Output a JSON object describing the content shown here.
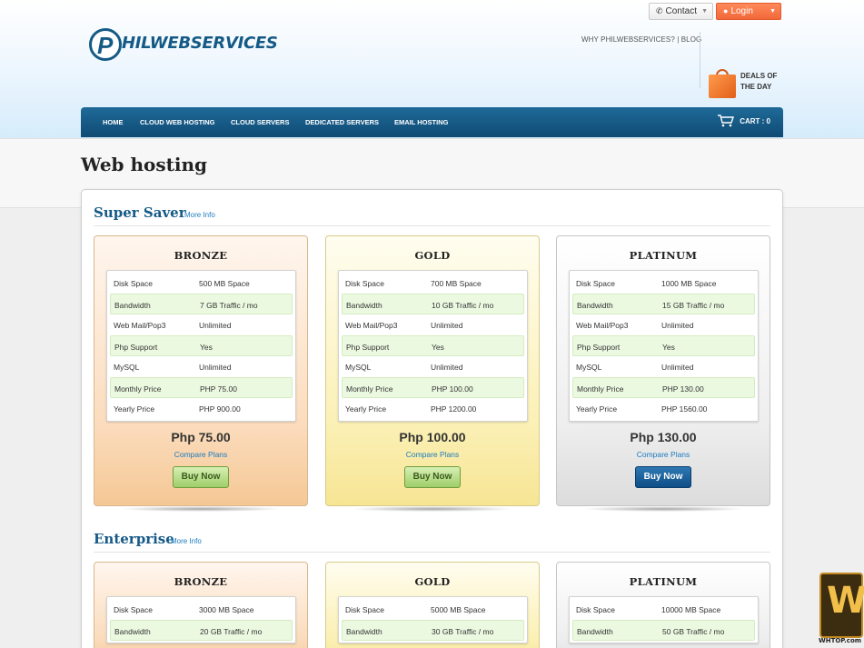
{
  "topbar": {
    "contact_label": "Contact",
    "login_label": "Login"
  },
  "brand": {
    "logo_letter": "P",
    "logo_text": "HILWEBSERVICES"
  },
  "toplinks": "WHY PHILWEBSERVICES? | BLOG",
  "deals": {
    "line1": "DEALS OF",
    "line2": "THE DAY"
  },
  "nav": {
    "items": [
      "HOME",
      "CLOUD WEB HOSTING",
      "CLOUD SERVERS",
      "DEDICATED SERVERS",
      "EMAIL HOSTING"
    ],
    "cart_label": "CART : 0"
  },
  "page_title": "Web hosting",
  "sections": [
    {
      "title": "Super Saver",
      "more": "More Info",
      "plans": [
        {
          "name": "BRONZE",
          "specs": [
            [
              "Disk Space",
              "500 MB Space"
            ],
            [
              "Bandwidth",
              "7 GB Traffic / mo"
            ],
            [
              "Web Mail/Pop3",
              "Unlimited"
            ],
            [
              "Php Support",
              "Yes"
            ],
            [
              "MySQL",
              "Unlimited"
            ],
            [
              "Monthly Price",
              "PHP 75.00"
            ],
            [
              "Yearly Price",
              "PHP 900.00"
            ]
          ],
          "price": "Php 75.00",
          "compare": "Compare Plans",
          "buy": "Buy Now"
        },
        {
          "name": "GOLD",
          "specs": [
            [
              "Disk Space",
              "700 MB Space"
            ],
            [
              "Bandwidth",
              "10 GB Traffic / mo"
            ],
            [
              "Web Mail/Pop3",
              "Unlimited"
            ],
            [
              "Php Support",
              "Yes"
            ],
            [
              "MySQL",
              "Unlimited"
            ],
            [
              "Monthly Price",
              "PHP 100.00"
            ],
            [
              "Yearly Price",
              "PHP 1200.00"
            ]
          ],
          "price": "Php 100.00",
          "compare": "Compare Plans",
          "buy": "Buy Now"
        },
        {
          "name": "PLATINUM",
          "specs": [
            [
              "Disk Space",
              "1000 MB Space"
            ],
            [
              "Bandwidth",
              "15 GB Traffic / mo"
            ],
            [
              "Web Mail/Pop3",
              "Unlimited"
            ],
            [
              "Php Support",
              "Yes"
            ],
            [
              "MySQL",
              "Unlimited"
            ],
            [
              "Monthly Price",
              "PHP 130.00"
            ],
            [
              "Yearly Price",
              "PHP 1560.00"
            ]
          ],
          "price": "Php 130.00",
          "compare": "Compare Plans",
          "buy": "Buy Now"
        }
      ]
    },
    {
      "title": "Enterprise",
      "more": "More Info",
      "plans": [
        {
          "name": "BRONZE",
          "specs": [
            [
              "Disk Space",
              "3000 MB Space"
            ],
            [
              "Bandwidth",
              "20 GB Traffic / mo"
            ]
          ]
        },
        {
          "name": "GOLD",
          "specs": [
            [
              "Disk Space",
              "5000 MB Space"
            ],
            [
              "Bandwidth",
              "30 GB Traffic / mo"
            ]
          ]
        },
        {
          "name": "PLATINUM",
          "specs": [
            [
              "Disk Space",
              "10000 MB Space"
            ],
            [
              "Bandwidth",
              "50 GB Traffic / mo"
            ]
          ]
        }
      ]
    }
  ],
  "watermark": {
    "letter": "W",
    "text": "WHTOP.com"
  }
}
